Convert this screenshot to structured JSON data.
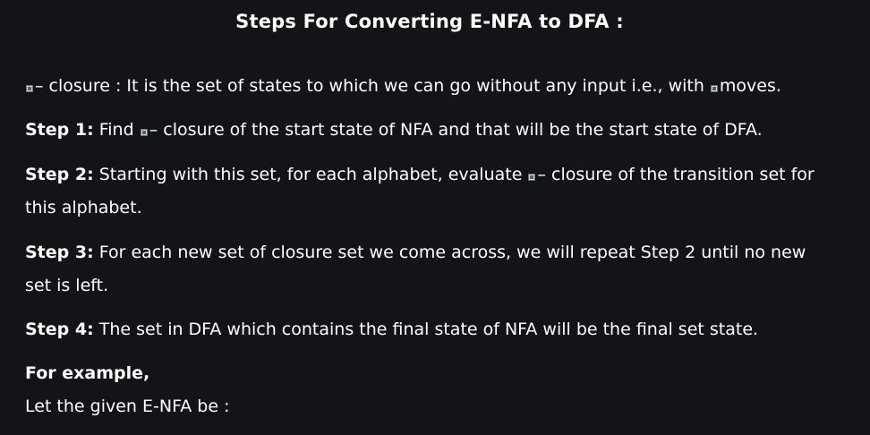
{
  "title": "Steps For Converting E-NFA to DFA :",
  "closure": {
    "part1": "– closure : It is the set of states to which we can go without any input i.e., with",
    "part2": "moves."
  },
  "step1": {
    "label": "Step 1:",
    "part1": "Find",
    "part2": "– closure of the start state of NFA and that will be the start state of DFA."
  },
  "step2": {
    "label": "Step 2:",
    "part1": "Starting with this set, for each alphabet, evaluate",
    "part2": "– closure of the transition set for this alphabet."
  },
  "step3": {
    "label": "Step 3:",
    "text": "For each new set of closure set we come across, we will repeat Step 2 until no new set is left."
  },
  "step4": {
    "label": "Step 4:",
    "text": "The set in DFA which contains the final state of NFA will be the final set state."
  },
  "example": {
    "label": "For example,",
    "text": "Let the given E-NFA be :"
  },
  "icons": {
    "epsilon": "epsilon-image-icon"
  },
  "colors": {
    "background": "#131417",
    "text": "#ffffff"
  }
}
